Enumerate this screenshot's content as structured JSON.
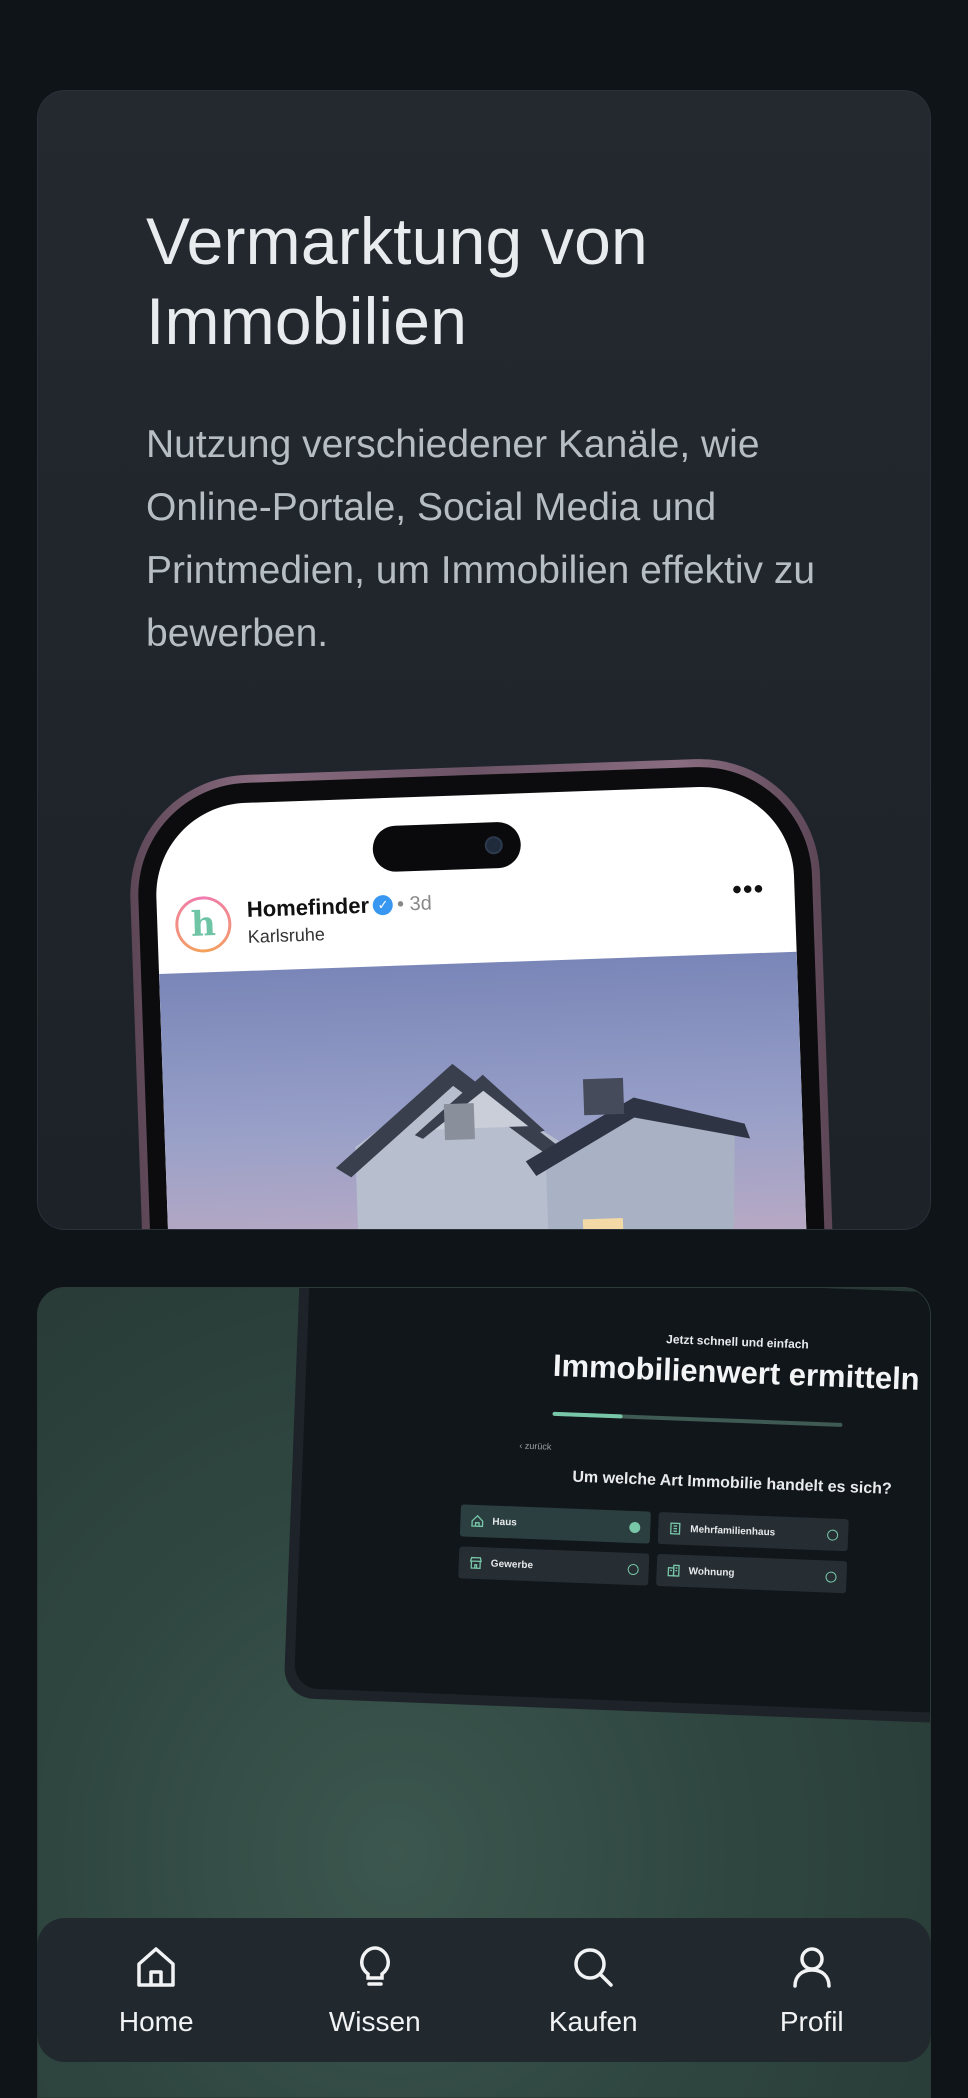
{
  "marketing_card": {
    "title_line1": "Vermarktung von",
    "title_line2": "Immobilien",
    "description": "Nutzung verschiedener Kanäle, wie Online-Portale, Social Media und Printmedien, um Immobilien effektiv zu bewerben."
  },
  "phone_post": {
    "avatar_letter": "h",
    "username": "Homefinder",
    "verified_mark": "✓",
    "age": "• 3d",
    "location": "Karlsruhe",
    "more_icon": "•••"
  },
  "valuation_card": {
    "kicker": "Jetzt schnell und einfach",
    "title": "Immobilienwert ermitteln",
    "progress": 0.24,
    "back_label": "‹ zurück",
    "question": "Um welche Art Immobilie handelt es sich?",
    "options": [
      {
        "label": "Haus",
        "icon": "house-icon",
        "selected": true
      },
      {
        "label": "Mehrfamilienhaus",
        "icon": "building-icon",
        "selected": false
      },
      {
        "label": "Gewerbe",
        "icon": "store-icon",
        "selected": false
      },
      {
        "label": "Wohnung",
        "icon": "apartment-icon",
        "selected": false
      }
    ]
  },
  "bottom_nav": {
    "items": [
      {
        "label": "Home",
        "icon": "home-icon"
      },
      {
        "label": "Wissen",
        "icon": "lightbulb-icon"
      },
      {
        "label": "Kaufen",
        "icon": "search-icon"
      },
      {
        "label": "Profil",
        "icon": "user-icon"
      }
    ]
  },
  "colors": {
    "background": "#0f1419",
    "card": "#23292f",
    "accent": "#78c7a8"
  }
}
